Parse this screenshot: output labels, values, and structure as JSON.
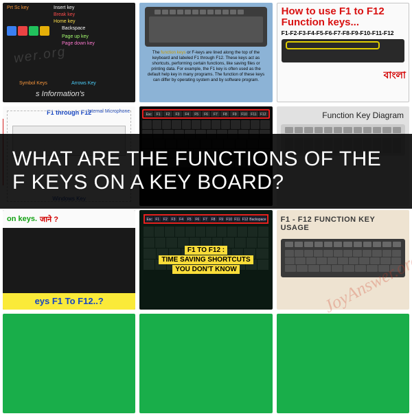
{
  "headline": "What are the functions of the F keys on a key board?",
  "watermark": "JoyAnswer.org",
  "watermark2": "wer.org",
  "tiles": {
    "t1": {
      "labels": [
        "Prt Sc key",
        "Insert key",
        "Break key",
        "Home key",
        "Backspace",
        "Page up key",
        "Page down key",
        "Symbol Keys",
        "Arrows Key"
      ],
      "footer": "s Information's"
    },
    "t2": {
      "caption_pre": "The ",
      "caption_hl": "function keys",
      "caption_post": " or F-keys are lined along the top of the keyboard and labeled F1 through F12. These keys act as shortcuts, performing certain functions, like saving files or printing data. For example, the F1 key is often used as the default help key in many programs. The function of these keys can differ by operating system and by software program."
    },
    "t3": {
      "title": "How to use F1 to F12 Function keys...",
      "sub": "F1-F2-F3-F4-F5-F6-F7-F8-F9-F10-F11-F12",
      "bangla": "বাংলা"
    },
    "t4": {
      "title": "F1 through F12",
      "mic": "Internal Microphone",
      "windows": "Windows Key"
    },
    "t5": {
      "fkeys": [
        "Esc",
        "F1",
        "F2",
        "F3",
        "F4",
        "F5",
        "F6",
        "F7",
        "F8",
        "F9",
        "F10",
        "F11",
        "F12"
      ]
    },
    "t6": {
      "title": "Function Key Diagram"
    },
    "t7": {
      "green": "on keys.",
      "red": "जाने ?",
      "footer": "eys F1 To F12..?"
    },
    "t8": {
      "fkeys": [
        "Esc",
        "F1",
        "F2",
        "F3",
        "F4",
        "F5",
        "F6",
        "F7",
        "F8",
        "F9",
        "F10",
        "F11",
        "F12",
        "Backspace"
      ],
      "line1": "F1 TO F12 :",
      "line2": "TIME SAVING SHORTCUTS",
      "line3": "YOU DON'T KNOW"
    },
    "t9": {
      "title": "F1 - F12 FUNCTION KEY USAGE"
    }
  }
}
